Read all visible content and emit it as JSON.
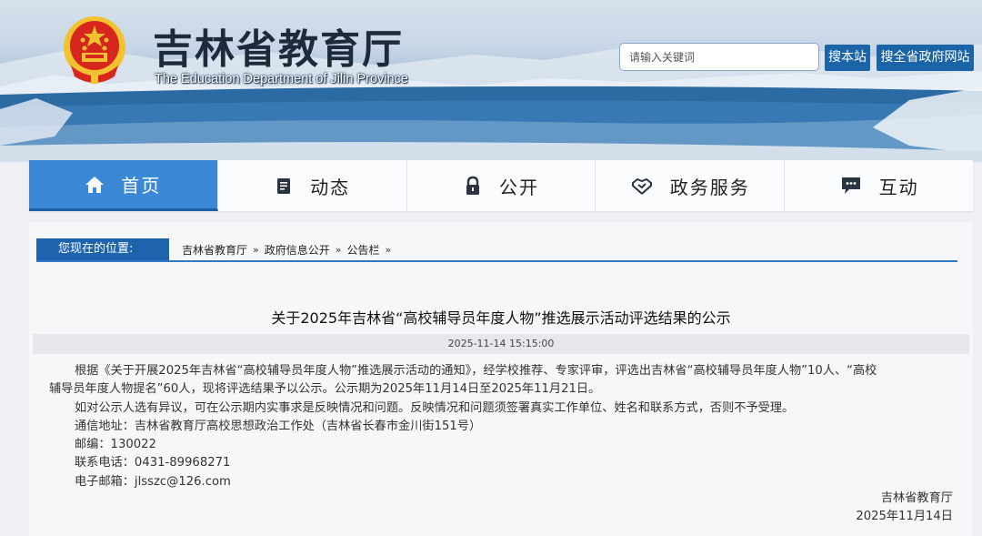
{
  "header": {
    "title": "吉林省教育厅",
    "subtitle": "The Education Department of Jilin Province",
    "search": {
      "placeholder": "请输入关键词",
      "btn_site": "搜本站",
      "btn_gov": "搜全省政府网站"
    }
  },
  "nav": {
    "items": [
      {
        "label": "首页",
        "icon": "home-icon",
        "active": true
      },
      {
        "label": "动态",
        "icon": "document-icon",
        "active": false
      },
      {
        "label": "公开",
        "icon": "lock-icon",
        "active": false
      },
      {
        "label": "政务服务",
        "icon": "handshake-icon",
        "active": false
      },
      {
        "label": "互动",
        "icon": "chat-icon",
        "active": false
      }
    ]
  },
  "breadcrumb": {
    "label": "您现在的位置:",
    "items": [
      "吉林省教育厅",
      "政府信息公开",
      "公告栏"
    ],
    "sep": "»"
  },
  "article": {
    "title": "关于2025年吉林省“高校辅导员年度人物”推选展示活动评选结果的公示",
    "date": "2025-11-14 15:15:00",
    "p1_line1": "根据《关于开展2025年吉林省“高校辅导员年度人物”推选展示活动的通知》，经学校推荐、专家评审，评选出吉林省“高校辅导员年度人物”10人、“高校",
    "p1_line2": "辅导员年度人物提名”60人，现将评选结果予以公示。公示期为2025年11月14日至2025年11月21日。",
    "p2": "如对公示人选有异议，可在公示期内实事求是反映情况和问题。反映情况和问题须签署真实工作单位、姓名和联系方式，否则不予受理。",
    "address": "通信地址：吉林省教育厅高校思想政治工作处（吉林省长春市金川街151号）",
    "postcode": "邮编：130022",
    "phone": "联系电话：0431-89968271",
    "email": "电子邮箱：jlsszc@126.com",
    "sign_org": "吉林省教育厅",
    "sign_date": "2025年11月14日"
  },
  "colors": {
    "nav_active": "#3b89d6",
    "button_blue": "#1c64a8",
    "breadcrumb_label": "#1e64ad",
    "emblem_red": "#d7261e",
    "emblem_gold": "#f2c230"
  }
}
